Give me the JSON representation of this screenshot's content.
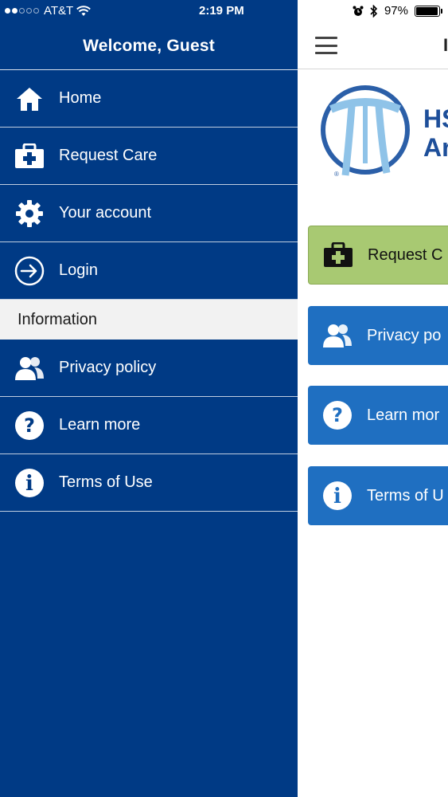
{
  "status_bar": {
    "carrier": "AT&T",
    "time": "2:19 PM",
    "battery_percent": "97%",
    "battery_level": 0.97
  },
  "drawer": {
    "title": "Welcome, Guest",
    "items": [
      {
        "label": "Home",
        "icon": "home-icon"
      },
      {
        "label": "Request Care",
        "icon": "medical-kit-icon"
      },
      {
        "label": "Your account",
        "icon": "gear-icon"
      },
      {
        "label": "Login",
        "icon": "login-icon"
      }
    ],
    "section_header": "Information",
    "info_items": [
      {
        "label": "Privacy policy",
        "icon": "users-icon"
      },
      {
        "label": "Learn more",
        "icon": "question-icon"
      },
      {
        "label": "Terms of Use",
        "icon": "info-icon"
      }
    ]
  },
  "main": {
    "logo_text_line1": "HS",
    "logo_text_line2": "Ar",
    "title_fragment": "I",
    "buttons": [
      {
        "label": "Request C",
        "icon": "medical-kit-icon",
        "color": "#a8c972"
      },
      {
        "label": "Privacy po",
        "icon": "users-icon",
        "color": "#1f6fc1"
      },
      {
        "label": "Learn mor",
        "icon": "question-icon",
        "color": "#1f6fc1"
      },
      {
        "label": "Terms of U",
        "icon": "info-icon",
        "color": "#1f6fc1"
      }
    ]
  },
  "colors": {
    "drawer_bg": "#003a85",
    "section_bg": "#f2f2f2",
    "green_button": "#a8c972",
    "blue_button": "#1f6fc1"
  }
}
